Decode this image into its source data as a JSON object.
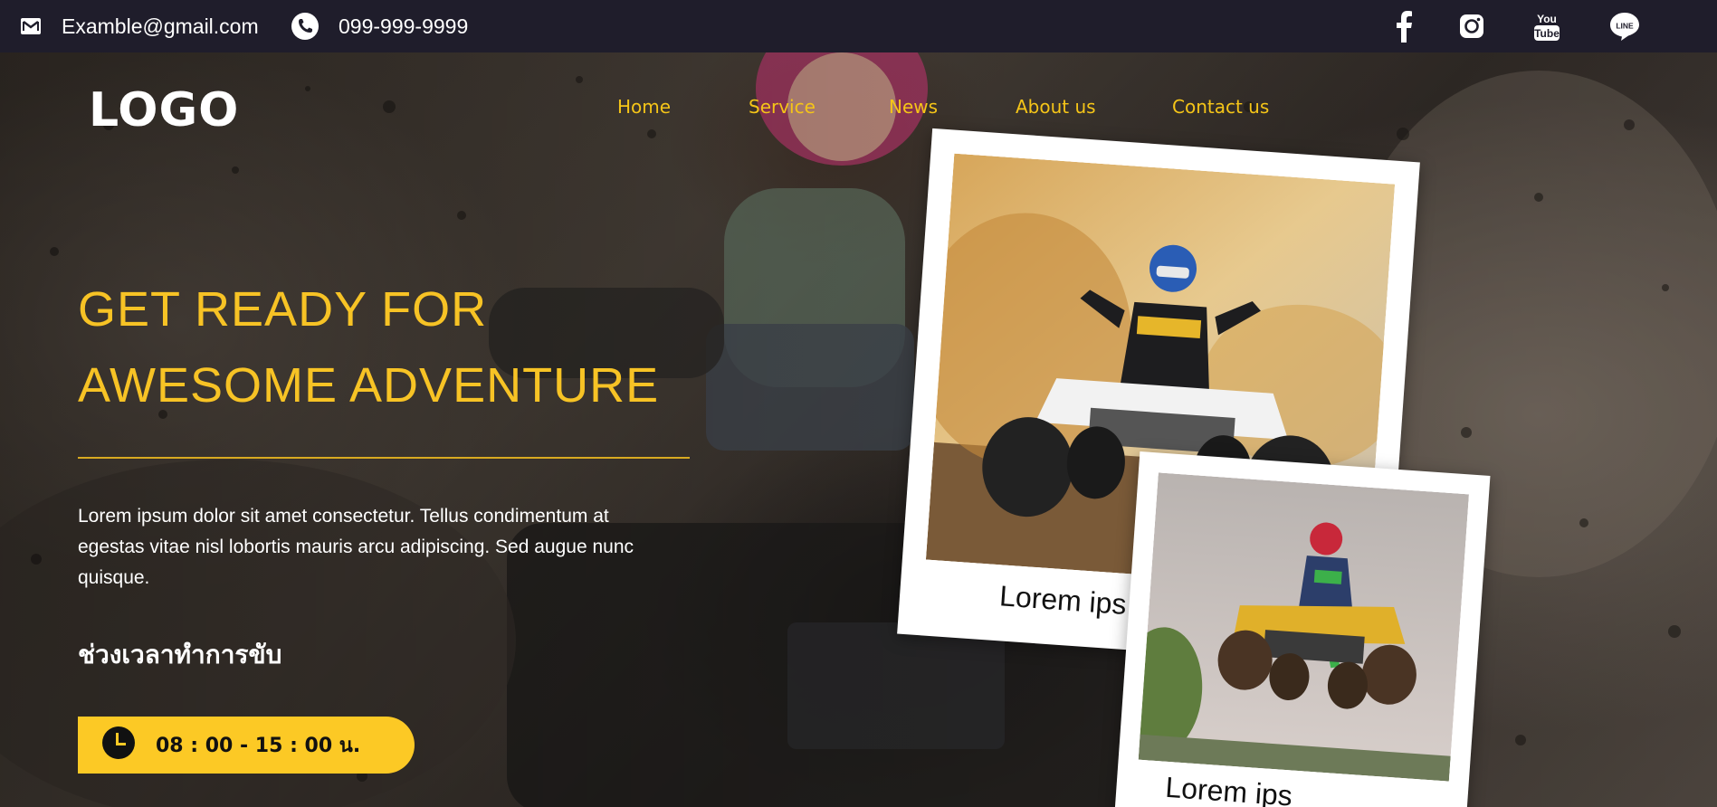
{
  "topbar": {
    "email": "Examble@gmail.com",
    "phone": "099-999-9999",
    "social_icons": [
      "facebook-icon",
      "instagram-icon",
      "youtube-icon",
      "line-icon"
    ]
  },
  "nav": {
    "logo": "LOGO",
    "items": [
      {
        "label": "Home"
      },
      {
        "label": "Service"
      },
      {
        "label": "News"
      },
      {
        "label": "About us"
      },
      {
        "label": "Contact us"
      }
    ]
  },
  "hero": {
    "headline_line1": "GET READY FOR",
    "headline_line2": "AWESOME ADVENTURE",
    "description": "Lorem ipsum dolor sit amet consectetur. Tellus condimentum at egestas vitae nisl lobortis mauris arcu adipiscing. Sed augue nunc quisque.",
    "hours_title": "ช่วงเวลาทำการขับ",
    "hours": "08 : 00 - 15 : 00 น."
  },
  "gallery": [
    {
      "caption": "Lorem ips"
    },
    {
      "caption": "Lorem ips"
    }
  ],
  "colors": {
    "topbar_bg": "#1f1d2b",
    "accent_yellow": "#f7c325",
    "nav_text": "#f5c518",
    "pill_bg": "#fcc925"
  }
}
